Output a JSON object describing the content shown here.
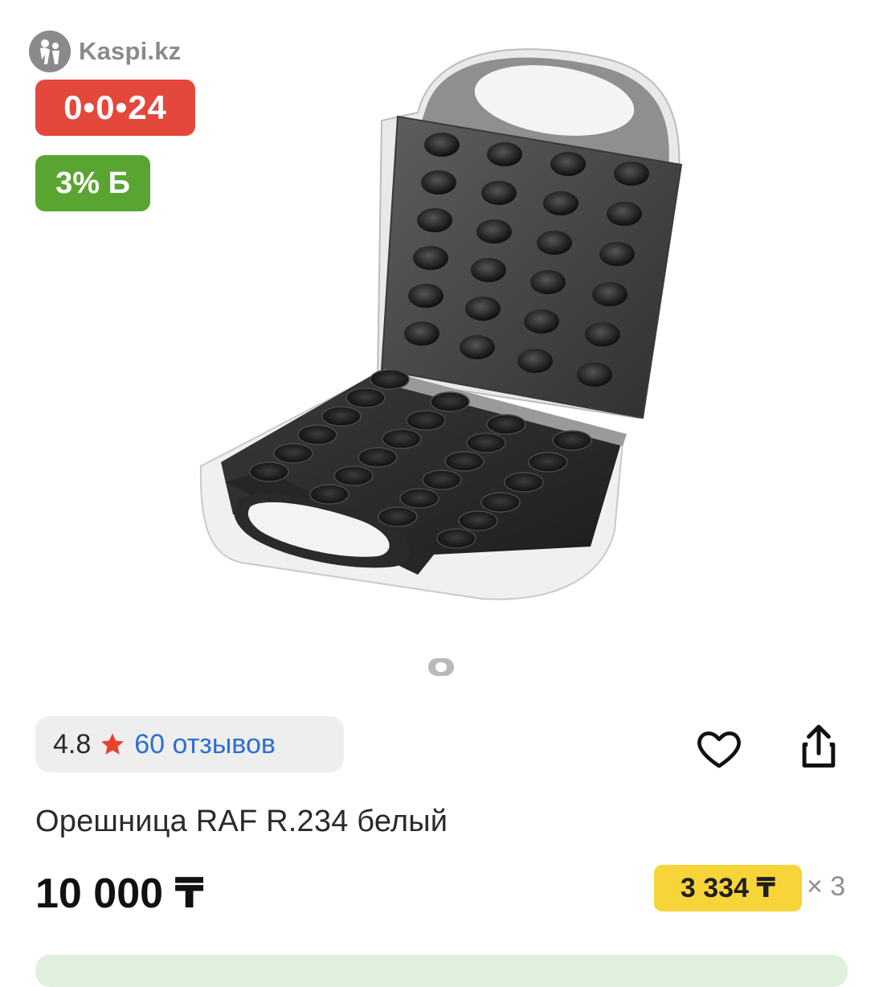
{
  "watermark": {
    "text": "Kaspi.kz",
    "icon": "kaspi-logo-icon"
  },
  "badges": {
    "installment": "0•0•24",
    "bonus": "3% Б"
  },
  "gallery": {
    "image": "waffle-maker-product-photo",
    "dots": 1
  },
  "rating": {
    "value": "4.8",
    "star_color": "#e8412f",
    "reviews": "60 отзывов",
    "icon": "star-icon"
  },
  "actions": {
    "favorite_icon": "heart-icon",
    "share_icon": "share-icon"
  },
  "product": {
    "title": "Орешница RAF R.234 белый"
  },
  "pricing": {
    "price": "10 000 ₸",
    "installment_price": "3 334 ₸",
    "installment_multiplier": "× 3",
    "installment_color": "#f7d43a"
  },
  "colors": {
    "link": "#2c6fd1",
    "installment_badge": "#e4483c",
    "bonus_badge": "#5aa531"
  }
}
